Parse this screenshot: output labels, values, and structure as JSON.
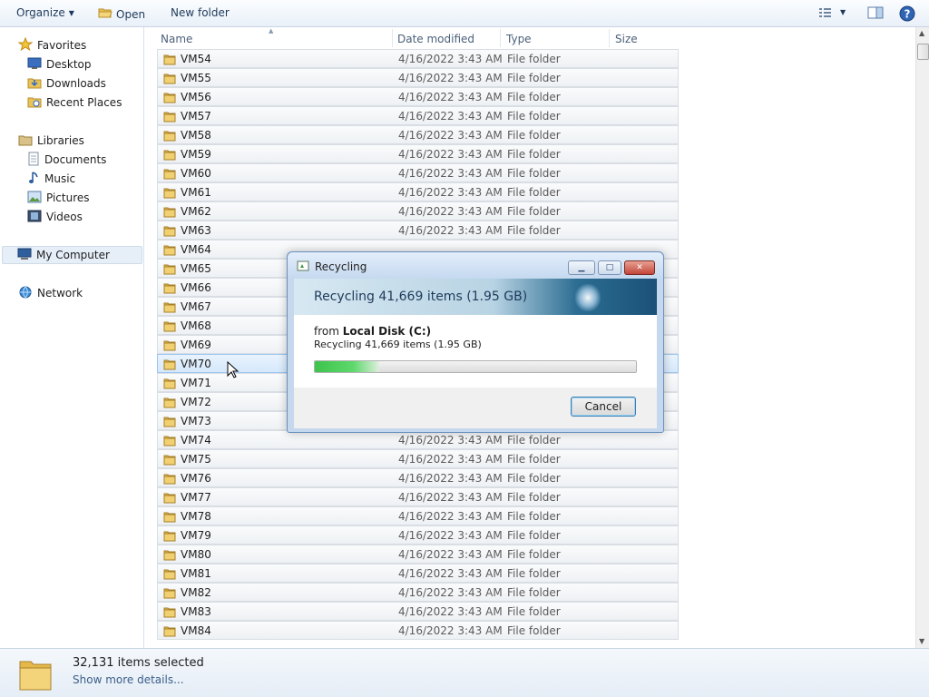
{
  "toolbar": {
    "organize_label": "Organize",
    "open_label": "Open",
    "new_folder_label": "New folder"
  },
  "nav": {
    "favorites": "Favorites",
    "favorites_items": [
      "Desktop",
      "Downloads",
      "Recent Places"
    ],
    "libraries": "Libraries",
    "libraries_items": [
      "Documents",
      "Music",
      "Pictures",
      "Videos"
    ],
    "my_computer": "My Computer",
    "network": "Network"
  },
  "columns": {
    "name": "Name",
    "date": "Date modified",
    "type": "Type",
    "size": "Size"
  },
  "rows": [
    {
      "name": "VM54",
      "date": "4/16/2022 3:43 AM",
      "type": "File folder"
    },
    {
      "name": "VM55",
      "date": "4/16/2022 3:43 AM",
      "type": "File folder"
    },
    {
      "name": "VM56",
      "date": "4/16/2022 3:43 AM",
      "type": "File folder"
    },
    {
      "name": "VM57",
      "date": "4/16/2022 3:43 AM",
      "type": "File folder"
    },
    {
      "name": "VM58",
      "date": "4/16/2022 3:43 AM",
      "type": "File folder"
    },
    {
      "name": "VM59",
      "date": "4/16/2022 3:43 AM",
      "type": "File folder"
    },
    {
      "name": "VM60",
      "date": "4/16/2022 3:43 AM",
      "type": "File folder"
    },
    {
      "name": "VM61",
      "date": "4/16/2022 3:43 AM",
      "type": "File folder"
    },
    {
      "name": "VM62",
      "date": "4/16/2022 3:43 AM",
      "type": "File folder"
    },
    {
      "name": "VM63",
      "date": "4/16/2022 3:43 AM",
      "type": "File folder"
    },
    {
      "name": "VM64",
      "date": "",
      "type": ""
    },
    {
      "name": "VM65",
      "date": "",
      "type": ""
    },
    {
      "name": "VM66",
      "date": "",
      "type": ""
    },
    {
      "name": "VM67",
      "date": "",
      "type": ""
    },
    {
      "name": "VM68",
      "date": "",
      "type": ""
    },
    {
      "name": "VM69",
      "date": "",
      "type": ""
    },
    {
      "name": "VM70",
      "date": "",
      "type": "",
      "selected": true
    },
    {
      "name": "VM71",
      "date": "",
      "type": ""
    },
    {
      "name": "VM72",
      "date": "",
      "type": ""
    },
    {
      "name": "VM73",
      "date": "",
      "type": ""
    },
    {
      "name": "VM74",
      "date": "4/16/2022 3:43 AM",
      "type": "File folder"
    },
    {
      "name": "VM75",
      "date": "4/16/2022 3:43 AM",
      "type": "File folder"
    },
    {
      "name": "VM76",
      "date": "4/16/2022 3:43 AM",
      "type": "File folder"
    },
    {
      "name": "VM77",
      "date": "4/16/2022 3:43 AM",
      "type": "File folder"
    },
    {
      "name": "VM78",
      "date": "4/16/2022 3:43 AM",
      "type": "File folder"
    },
    {
      "name": "VM79",
      "date": "4/16/2022 3:43 AM",
      "type": "File folder"
    },
    {
      "name": "VM80",
      "date": "4/16/2022 3:43 AM",
      "type": "File folder"
    },
    {
      "name": "VM81",
      "date": "4/16/2022 3:43 AM",
      "type": "File folder"
    },
    {
      "name": "VM82",
      "date": "4/16/2022 3:43 AM",
      "type": "File folder"
    },
    {
      "name": "VM83",
      "date": "4/16/2022 3:43 AM",
      "type": "File folder"
    },
    {
      "name": "VM84",
      "date": "4/16/2022 3:43 AM",
      "type": "File folder"
    }
  ],
  "details": {
    "count": "32,131 items selected",
    "more": "Show more details..."
  },
  "dialog": {
    "title": "Recycling",
    "heading": "Recycling 41,669 items (1.95 GB)",
    "from_prefix": "from",
    "from_location": "Local Disk (C:)",
    "subline": "Recycling 41,669 items (1.95 GB)",
    "progress": 0.2,
    "cancel_label": "Cancel"
  },
  "colors": {
    "accent": "#3a5f8a",
    "progress_green": "#3cc44c",
    "selection": "#d6e8fb"
  }
}
